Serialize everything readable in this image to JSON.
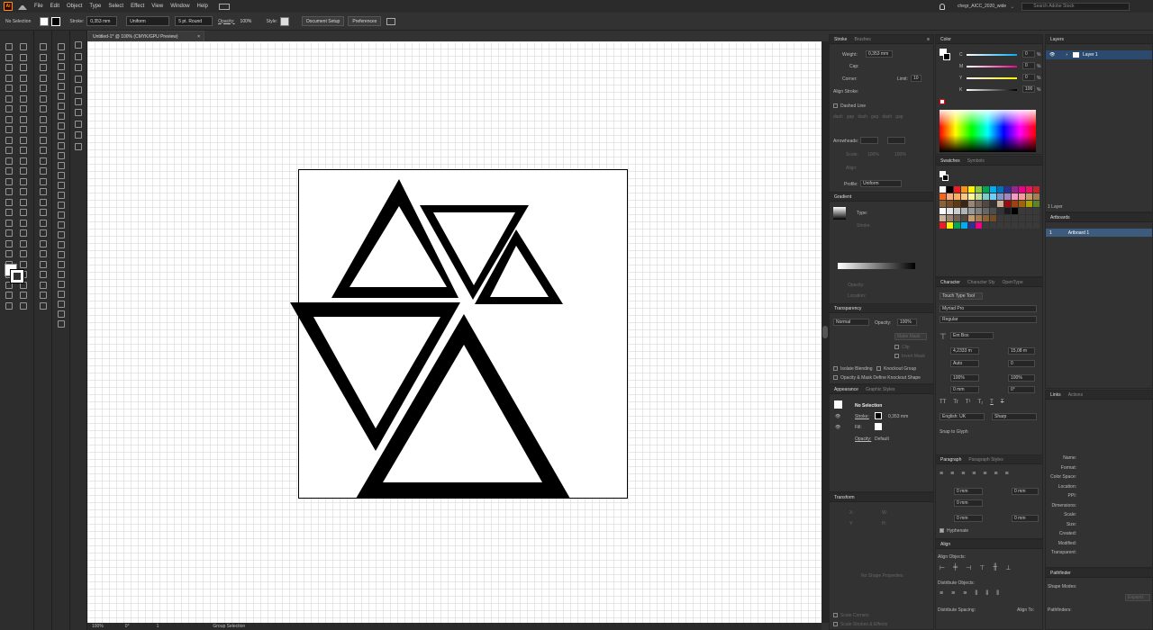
{
  "app": {
    "logo": "Ai",
    "workspace": "chegr_AICC_2020_wide",
    "search_placeholder": "Search Adobe Stock"
  },
  "menu": [
    "File",
    "Edit",
    "Object",
    "Type",
    "Select",
    "Effect",
    "View",
    "Window",
    "Help"
  ],
  "control_bar": {
    "selection_label": "No Selection",
    "stroke_label": "Stroke:",
    "stroke_value": "0,353 mm",
    "profile_value": "Uniform",
    "brush_value": "5 pt. Round",
    "opacity_label": "Opacity:",
    "opacity_value": "100%",
    "style_label": "Style:",
    "doc_setup_button": "Document Setup",
    "preferences_button": "Preferences"
  },
  "document": {
    "tab_title": "Untitled-1* @ 100% (CMYK/GPU Preview)",
    "close": "×"
  },
  "status": {
    "zoom": "100%",
    "rotation": "0°",
    "page": "1",
    "tool": "Group Selection"
  },
  "stroke_panel": {
    "tab_active": "Stroke",
    "tab_other": "Brushes",
    "weight_label": "Weight:",
    "weight_value": "0,353 mm",
    "cap_label": "Cap:",
    "corner_label": "Corner:",
    "limit_label": "Limit:",
    "limit_value": "10",
    "align_label": "Align Stroke:",
    "dashed_label": "Dashed Line",
    "dash_cells": [
      "dash",
      "gap",
      "dash",
      "gap",
      "dash",
      "gap"
    ],
    "arrowheads_label": "Arrowheads:",
    "scale_label": "Scale:",
    "scale1": "100%",
    "scale2": "100%",
    "align2_label": "Align:",
    "profile_label": "Profile:",
    "profile_value": "Uniform"
  },
  "gradient_panel": {
    "title": "Gradient",
    "type_label": "Type:",
    "stroke_label": "Stroke:",
    "opacity_label": "Opacity:",
    "location_label": "Location:"
  },
  "transparency_panel": {
    "title": "Transparency",
    "mode": "Normal",
    "opacity_label": "Opacity:",
    "opacity_value": "100%",
    "make_mask": "Make Mask",
    "clip": "Clip",
    "invert": "Invert Mask",
    "isolate": "Isolate Blending",
    "knockout": "Knockout Group",
    "define_knockout": "Opacity & Mask Define Knockout Shape"
  },
  "appearance_panel": {
    "tab_active": "Appearance",
    "tab_other": "Graphic Styles",
    "no_selection": "No Selection",
    "stroke_label": "Stroke:",
    "stroke_value": "0,353 mm",
    "fill_label": "Fill:",
    "opacity_label": "Opacity:",
    "opacity_value": "Default"
  },
  "transform_panel": {
    "title": "Transform",
    "x": "X:",
    "y": "Y:",
    "w": "W:",
    "h": "H:",
    "no_shape": "No Shape Properties",
    "scale_corners": "Scale Corners",
    "scale_strokes": "Scale Strokes & Effects"
  },
  "color_panel": {
    "title": "Color",
    "rows": [
      {
        "label": "C",
        "value": "0",
        "unit": "%"
      },
      {
        "label": "M",
        "value": "0",
        "unit": "%"
      },
      {
        "label": "Y",
        "value": "0",
        "unit": "%"
      },
      {
        "label": "K",
        "value": "100",
        "unit": "%"
      }
    ]
  },
  "swatches_panel": {
    "tab_active": "Swatches",
    "tab_other": "Symbols"
  },
  "character_panel": {
    "tab_active": "Character",
    "tab_2": "Character Sty",
    "tab_3": "OpenType",
    "touch_tool": "Touch Type Tool",
    "font": "Myriad Pro",
    "style": "Regular",
    "em_box": "Em Box",
    "size": "4,2333 m",
    "leading": "15,08 m",
    "kerning": "Auto",
    "tracking": "0",
    "vscale": "100%",
    "hscale": "100%",
    "baseline": "0 mm",
    "rotation": "0°",
    "tt": "TT",
    "tr": "Tr",
    "t1": "T¹",
    "t2": "T₁",
    "tu": "T",
    "ts": "T",
    "language": "English: UK",
    "aa": "Sharp",
    "snap": "Snap to Glyph"
  },
  "paragraph_panel": {
    "tab_active": "Paragraph",
    "tab_other": "Paragraph Styles",
    "indent1": "0 mm",
    "indent2": "0 mm",
    "indent3": "0 mm",
    "space1": "0 mm",
    "space2": "0 mm",
    "hyphenate": "Hyphenate"
  },
  "align_panel": {
    "title": "Align",
    "align_objects": "Align Objects:",
    "distribute_objects": "Distribute Objects:",
    "distribute_spacing": "Distribute Spacing:",
    "align_to": "Align To:"
  },
  "layers_panel": {
    "title": "Layers",
    "layer_name": "Layer 1",
    "count": "1 Layer"
  },
  "artboards_panel": {
    "title": "Artboards",
    "index": "1",
    "name": "Artboard 1"
  },
  "links_panel": {
    "tab_active": "Links",
    "tab_other": "Actions",
    "fields": [
      "Name:",
      "Format:",
      "Color Space:",
      "Location:",
      "PPI:",
      "Dimensions:",
      "Scale:",
      "Size:",
      "Created:",
      "Modified:",
      "Transparent:"
    ]
  },
  "pathfinder_panel": {
    "title": "Pathfinder",
    "shape_modes": "Shape Modes:",
    "expand": "Expand",
    "pathfinders": "Pathfinders:"
  },
  "colors": {
    "accent": "#2c4a6e",
    "canvas": "#ffffff",
    "ui_bg": "#323232"
  },
  "artwork": {
    "triangles": [
      {
        "orientation": "up",
        "label": "triangle-large-bottom"
      },
      {
        "orientation": "down",
        "label": "triangle-left-inverted"
      },
      {
        "orientation": "up",
        "label": "triangle-top-left"
      },
      {
        "orientation": "down",
        "label": "triangle-top-middle-inverted"
      },
      {
        "orientation": "up",
        "label": "triangle-small-right"
      }
    ]
  }
}
